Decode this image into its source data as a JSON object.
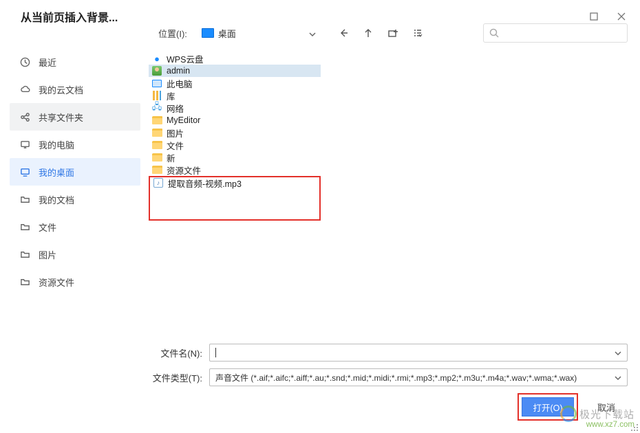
{
  "window": {
    "title": "从当前页插入背景..."
  },
  "toolbar": {
    "location_label": "位置(I):",
    "location_value": "桌面",
    "search_placeholder": ""
  },
  "sidebar": {
    "items": [
      {
        "id": "recent",
        "label": "最近",
        "icon": "clock"
      },
      {
        "id": "mycloud",
        "label": "我的云文档",
        "icon": "cloud"
      },
      {
        "id": "shared",
        "label": "共享文件夹",
        "icon": "share",
        "state": "gray"
      },
      {
        "id": "mypc",
        "label": "我的电脑",
        "icon": "monitor"
      },
      {
        "id": "mydesktop",
        "label": "我的桌面",
        "icon": "desktop",
        "state": "blue"
      },
      {
        "id": "mydocs",
        "label": "我的文档",
        "icon": "folder"
      },
      {
        "id": "files",
        "label": "文件",
        "icon": "folder"
      },
      {
        "id": "pictures",
        "label": "图片",
        "icon": "folder"
      },
      {
        "id": "resources",
        "label": "资源文件",
        "icon": "folder"
      }
    ]
  },
  "files": {
    "items": [
      {
        "name": "WPS云盘",
        "icon": "cloud"
      },
      {
        "name": "admin",
        "icon": "user",
        "selected": true
      },
      {
        "name": "此电脑",
        "icon": "pc"
      },
      {
        "name": "库",
        "icon": "lib"
      },
      {
        "name": "网络",
        "icon": "net"
      },
      {
        "name": "MyEditor",
        "icon": "folder"
      },
      {
        "name": "图片",
        "icon": "folder"
      },
      {
        "name": "文件",
        "icon": "folder"
      },
      {
        "name": "新",
        "icon": "folder"
      },
      {
        "name": "资源文件",
        "icon": "folder"
      },
      {
        "name": "提取音频-视频.mp3",
        "icon": "music",
        "highlighted": true
      }
    ]
  },
  "bottom": {
    "filename_label": "文件名(N):",
    "filename_value": "",
    "filetype_label": "文件类型(T):",
    "filetype_value": "声音文件 (*.aif;*.aifc;*.aiff;*.au;*.snd;*.mid;*.midi;*.rmi;*.mp3;*.mp2;*.m3u;*.m4a;*.wav;*.wma;*.wax)",
    "open_label": "打开(O)",
    "cancel_label": "取消"
  },
  "watermark": {
    "text": "极光下载站",
    "url": "www.xz7.com"
  }
}
